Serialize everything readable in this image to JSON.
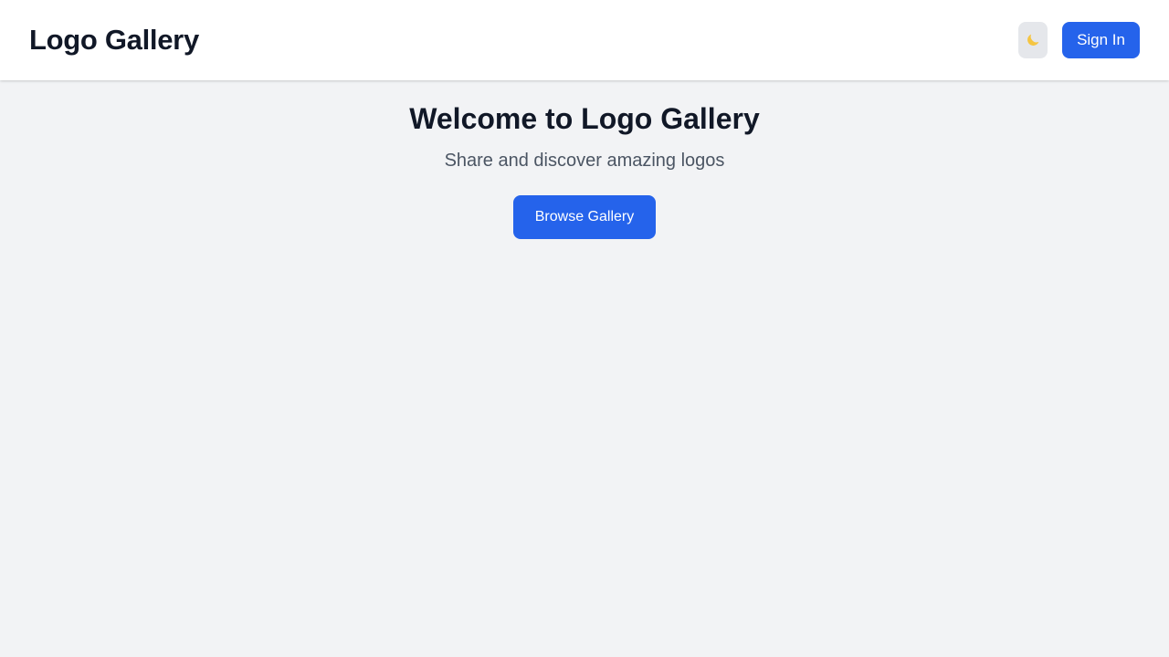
{
  "header": {
    "brand": "Logo Gallery",
    "theme_toggle_icon": "moon-icon",
    "signin_label": "Sign In"
  },
  "hero": {
    "title": "Welcome to Logo Gallery",
    "subtitle": "Share and discover amazing logos",
    "browse_label": "Browse Gallery"
  },
  "colors": {
    "accent": "#2563eb",
    "page_background": "#f2f3f5",
    "header_background": "#ffffff",
    "heading_text": "#111827",
    "muted_text": "#4b5563",
    "moon": "#f5c542"
  }
}
